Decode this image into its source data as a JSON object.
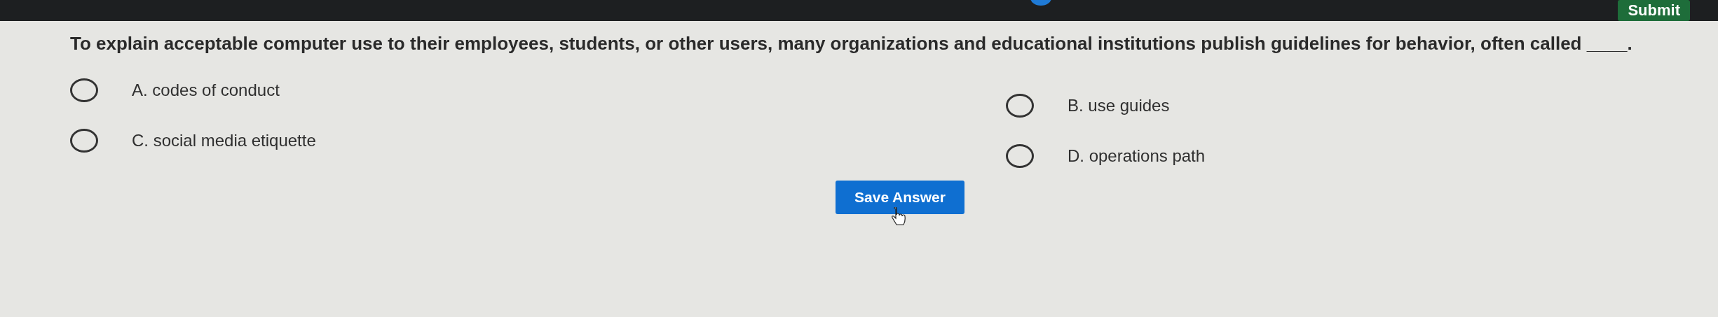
{
  "top_bar": {
    "submit_label": "Submit"
  },
  "question": "To explain acceptable computer use to their employees, students, or other users, many organizations and educational institutions publish guidelines for behavior, often called ____.",
  "options": [
    {
      "label": "A. codes of conduct",
      "selected": false
    },
    {
      "label": "B. use guides",
      "selected": false
    },
    {
      "label": "C. social media etiquette",
      "selected": false
    },
    {
      "label": "D. operations path",
      "selected": false
    }
  ],
  "save_label": "Save Answer"
}
